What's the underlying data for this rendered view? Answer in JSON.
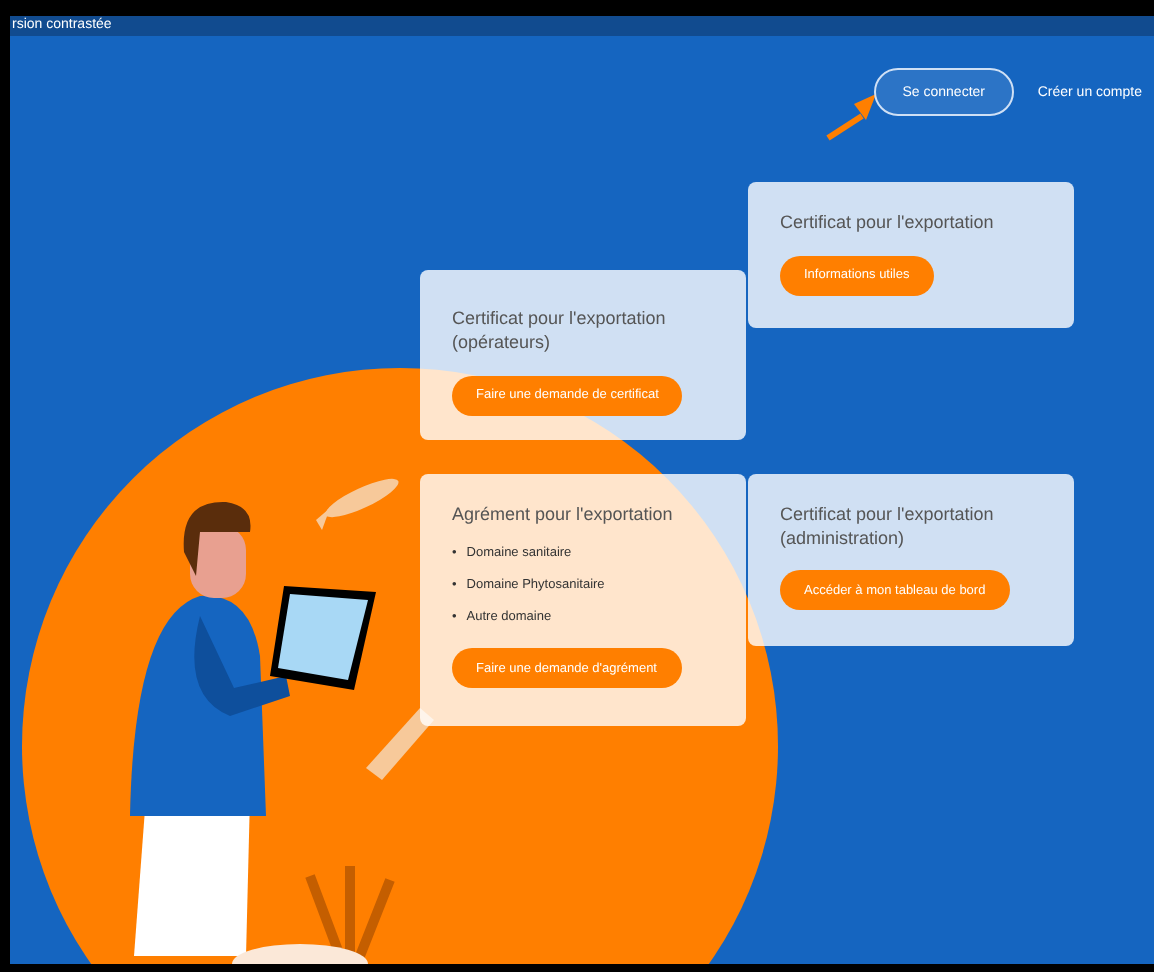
{
  "top_bar": {
    "text": "rsion contrastée"
  },
  "header": {
    "login_button": "Se connecter",
    "signup_link": "Créer un compte"
  },
  "cards": [
    {
      "title": "Certificat pour l'exportation",
      "button": "Informations utiles"
    },
    {
      "title": "Certificat pour l'exportation (opérateurs)",
      "button": "Faire une demande de certificat"
    },
    {
      "title": "Agrément pour l'exportation",
      "items": [
        {
          "bullet": "•",
          "text": "Domaine sanitaire"
        },
        {
          "bullet": "•",
          "text": "Domaine Phytosanitaire"
        },
        {
          "bullet": "•",
          "text": "Autre domaine"
        }
      ],
      "button": "Faire une demande d'agrément"
    },
    {
      "title": "Certificat pour l'exportation (administration)",
      "button": "Accéder à mon tableau de bord"
    }
  ]
}
